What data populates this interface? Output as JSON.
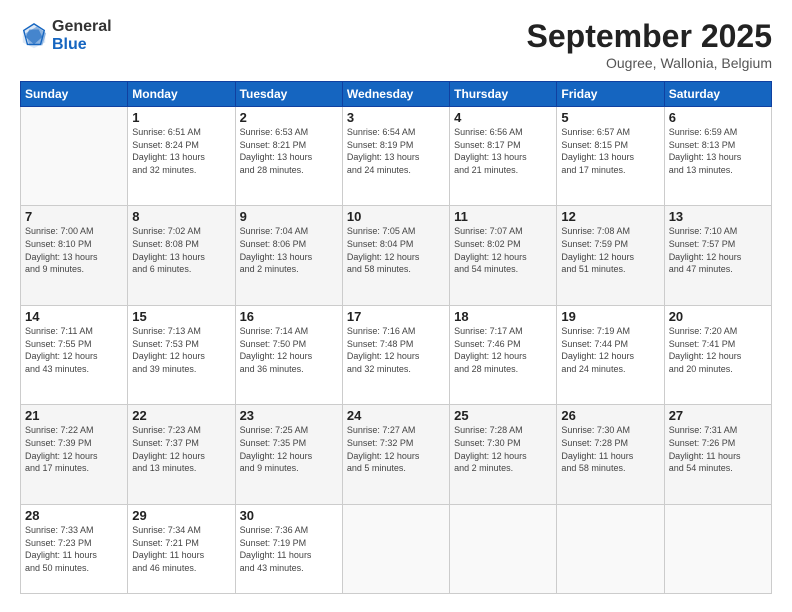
{
  "logo": {
    "general": "General",
    "blue": "Blue"
  },
  "header": {
    "month": "September 2025",
    "location": "Ougree, Wallonia, Belgium"
  },
  "weekdays": [
    "Sunday",
    "Monday",
    "Tuesday",
    "Wednesday",
    "Thursday",
    "Friday",
    "Saturday"
  ],
  "weeks": [
    [
      {
        "day": "",
        "info": ""
      },
      {
        "day": "1",
        "info": "Sunrise: 6:51 AM\nSunset: 8:24 PM\nDaylight: 13 hours\nand 32 minutes."
      },
      {
        "day": "2",
        "info": "Sunrise: 6:53 AM\nSunset: 8:21 PM\nDaylight: 13 hours\nand 28 minutes."
      },
      {
        "day": "3",
        "info": "Sunrise: 6:54 AM\nSunset: 8:19 PM\nDaylight: 13 hours\nand 24 minutes."
      },
      {
        "day": "4",
        "info": "Sunrise: 6:56 AM\nSunset: 8:17 PM\nDaylight: 13 hours\nand 21 minutes."
      },
      {
        "day": "5",
        "info": "Sunrise: 6:57 AM\nSunset: 8:15 PM\nDaylight: 13 hours\nand 17 minutes."
      },
      {
        "day": "6",
        "info": "Sunrise: 6:59 AM\nSunset: 8:13 PM\nDaylight: 13 hours\nand 13 minutes."
      }
    ],
    [
      {
        "day": "7",
        "info": "Sunrise: 7:00 AM\nSunset: 8:10 PM\nDaylight: 13 hours\nand 9 minutes."
      },
      {
        "day": "8",
        "info": "Sunrise: 7:02 AM\nSunset: 8:08 PM\nDaylight: 13 hours\nand 6 minutes."
      },
      {
        "day": "9",
        "info": "Sunrise: 7:04 AM\nSunset: 8:06 PM\nDaylight: 13 hours\nand 2 minutes."
      },
      {
        "day": "10",
        "info": "Sunrise: 7:05 AM\nSunset: 8:04 PM\nDaylight: 12 hours\nand 58 minutes."
      },
      {
        "day": "11",
        "info": "Sunrise: 7:07 AM\nSunset: 8:02 PM\nDaylight: 12 hours\nand 54 minutes."
      },
      {
        "day": "12",
        "info": "Sunrise: 7:08 AM\nSunset: 7:59 PM\nDaylight: 12 hours\nand 51 minutes."
      },
      {
        "day": "13",
        "info": "Sunrise: 7:10 AM\nSunset: 7:57 PM\nDaylight: 12 hours\nand 47 minutes."
      }
    ],
    [
      {
        "day": "14",
        "info": "Sunrise: 7:11 AM\nSunset: 7:55 PM\nDaylight: 12 hours\nand 43 minutes."
      },
      {
        "day": "15",
        "info": "Sunrise: 7:13 AM\nSunset: 7:53 PM\nDaylight: 12 hours\nand 39 minutes."
      },
      {
        "day": "16",
        "info": "Sunrise: 7:14 AM\nSunset: 7:50 PM\nDaylight: 12 hours\nand 36 minutes."
      },
      {
        "day": "17",
        "info": "Sunrise: 7:16 AM\nSunset: 7:48 PM\nDaylight: 12 hours\nand 32 minutes."
      },
      {
        "day": "18",
        "info": "Sunrise: 7:17 AM\nSunset: 7:46 PM\nDaylight: 12 hours\nand 28 minutes."
      },
      {
        "day": "19",
        "info": "Sunrise: 7:19 AM\nSunset: 7:44 PM\nDaylight: 12 hours\nand 24 minutes."
      },
      {
        "day": "20",
        "info": "Sunrise: 7:20 AM\nSunset: 7:41 PM\nDaylight: 12 hours\nand 20 minutes."
      }
    ],
    [
      {
        "day": "21",
        "info": "Sunrise: 7:22 AM\nSunset: 7:39 PM\nDaylight: 12 hours\nand 17 minutes."
      },
      {
        "day": "22",
        "info": "Sunrise: 7:23 AM\nSunset: 7:37 PM\nDaylight: 12 hours\nand 13 minutes."
      },
      {
        "day": "23",
        "info": "Sunrise: 7:25 AM\nSunset: 7:35 PM\nDaylight: 12 hours\nand 9 minutes."
      },
      {
        "day": "24",
        "info": "Sunrise: 7:27 AM\nSunset: 7:32 PM\nDaylight: 12 hours\nand 5 minutes."
      },
      {
        "day": "25",
        "info": "Sunrise: 7:28 AM\nSunset: 7:30 PM\nDaylight: 12 hours\nand 2 minutes."
      },
      {
        "day": "26",
        "info": "Sunrise: 7:30 AM\nSunset: 7:28 PM\nDaylight: 11 hours\nand 58 minutes."
      },
      {
        "day": "27",
        "info": "Sunrise: 7:31 AM\nSunset: 7:26 PM\nDaylight: 11 hours\nand 54 minutes."
      }
    ],
    [
      {
        "day": "28",
        "info": "Sunrise: 7:33 AM\nSunset: 7:23 PM\nDaylight: 11 hours\nand 50 minutes."
      },
      {
        "day": "29",
        "info": "Sunrise: 7:34 AM\nSunset: 7:21 PM\nDaylight: 11 hours\nand 46 minutes."
      },
      {
        "day": "30",
        "info": "Sunrise: 7:36 AM\nSunset: 7:19 PM\nDaylight: 11 hours\nand 43 minutes."
      },
      {
        "day": "",
        "info": ""
      },
      {
        "day": "",
        "info": ""
      },
      {
        "day": "",
        "info": ""
      },
      {
        "day": "",
        "info": ""
      }
    ]
  ]
}
